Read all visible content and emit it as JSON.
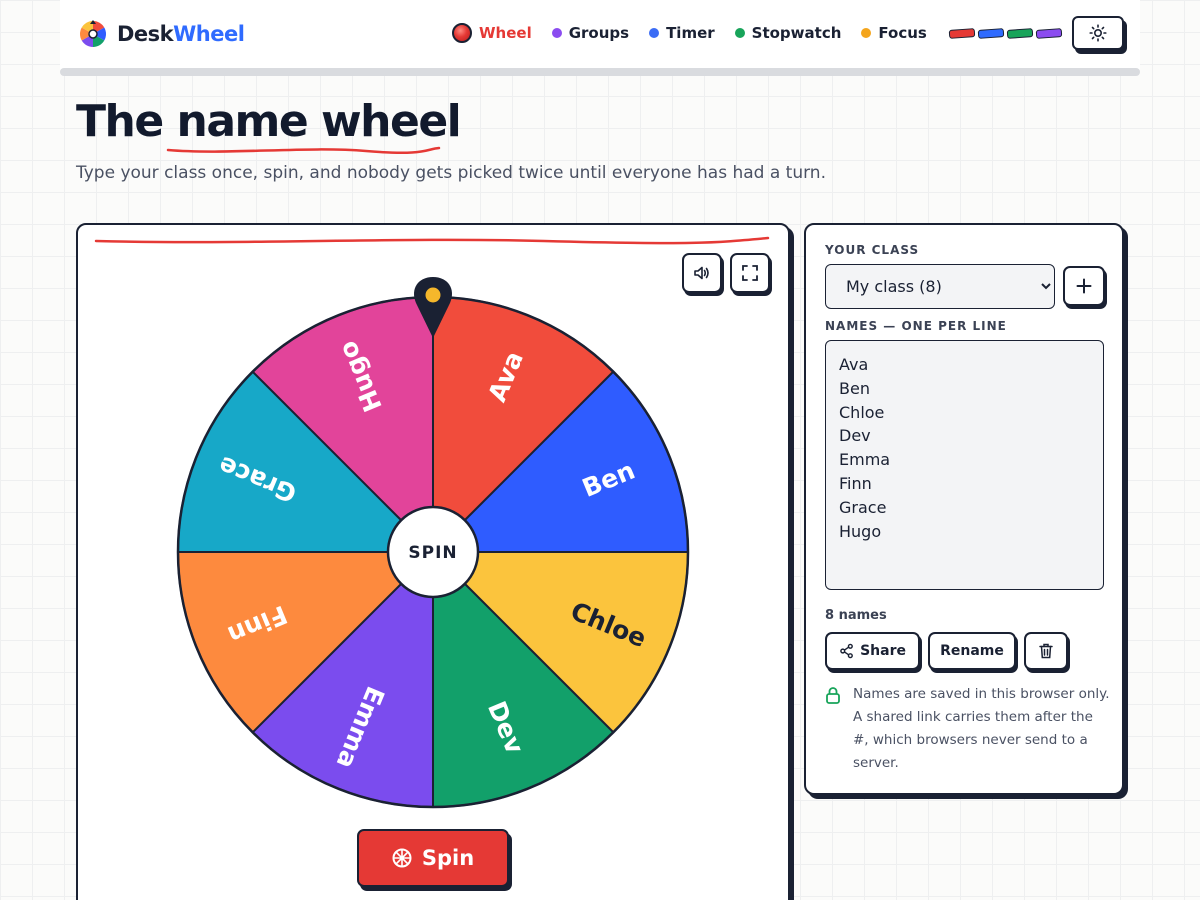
{
  "brand": {
    "name_part1": "Desk",
    "name_part2": "Wheel"
  },
  "nav": {
    "items": [
      {
        "label": "Wheel",
        "color": "#e53935",
        "active": true
      },
      {
        "label": "Groups",
        "color": "#8b4cf0",
        "active": false
      },
      {
        "label": "Timer",
        "color": "#3b6cf5",
        "active": false
      },
      {
        "label": "Stopwatch",
        "color": "#18a45a",
        "active": false
      },
      {
        "label": "Focus",
        "color": "#f4a51c",
        "active": false
      }
    ],
    "chips": [
      "#e53935",
      "#2f6bff",
      "#18a45a",
      "#8b4cf0"
    ],
    "theme_icon": "sun-icon"
  },
  "page": {
    "title_part1": "The ",
    "title_part2": "name wheel",
    "subtitle": "Type your class once, spin, and nobody gets picked twice until everyone has had a turn."
  },
  "wheel": {
    "center_label": "SPIN",
    "spin_button_label": "Spin",
    "pointer_color": "#1a2133",
    "pointer_dot_color": "#f5b72b",
    "segments": [
      {
        "name": "Ava",
        "color": "#f14c3c",
        "text_color": "#ffffff"
      },
      {
        "name": "Ben",
        "color": "#2f5cff",
        "text_color": "#ffffff"
      },
      {
        "name": "Chloe",
        "color": "#fbc43d",
        "text_color": "#1a2133"
      },
      {
        "name": "Dev",
        "color": "#12a06a",
        "text_color": "#ffffff"
      },
      {
        "name": "Emma",
        "color": "#7b4cee",
        "text_color": "#ffffff"
      },
      {
        "name": "Finn",
        "color": "#fd8a3e",
        "text_color": "#ffffff"
      },
      {
        "name": "Grace",
        "color": "#17a8c8",
        "text_color": "#ffffff"
      },
      {
        "name": "Hugo",
        "color": "#e2449a",
        "text_color": "#ffffff"
      }
    ]
  },
  "panel": {
    "class_label": "YOUR CLASS",
    "selected_class": "My class (8)",
    "names_label": "NAMES — ONE PER LINE",
    "names_text": "Ava\nBen\nChloe\nDev\nEmma\nFinn\nGrace\nHugo",
    "count_text": "8 names",
    "share_label": "Share",
    "rename_label": "Rename",
    "privacy_text": "Names are saved in this browser only. A shared link carries them after the #, which browsers never send to a server.",
    "lock_color": "#18a45a"
  }
}
